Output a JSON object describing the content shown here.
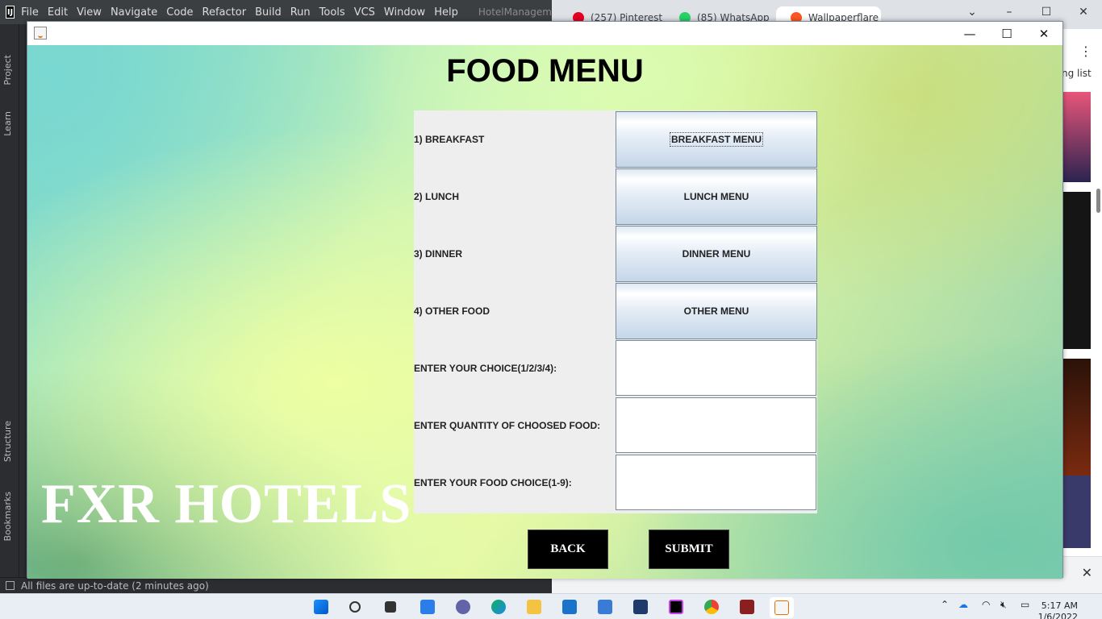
{
  "ide": {
    "menu": [
      "File",
      "Edit",
      "View",
      "Navigate",
      "Code",
      "Refactor",
      "Build",
      "Run",
      "Tools",
      "VCS",
      "Window",
      "Help"
    ],
    "project_title": "HotelManagementSystem",
    "side_tabs": {
      "project": "Project",
      "learn": "Learn",
      "structure": "Structure",
      "bookmarks": "Bookmarks"
    },
    "status": "All files are up-to-date (2 minutes ago)"
  },
  "browser": {
    "tabs": [
      {
        "label": "(257) Pinterest",
        "color": "#e60023"
      },
      {
        "label": "(85) WhatsApp",
        "color": "#25d366"
      },
      {
        "label": "Wallpaperflare",
        "color": "#ff5722"
      }
    ],
    "reading_list": "ng list"
  },
  "app": {
    "title": "FOOD MENU",
    "rows": [
      {
        "label": "1) BREAKFAST",
        "button": "BREAKFAST MENU"
      },
      {
        "label": "2) LUNCH",
        "button": "LUNCH MENU"
      },
      {
        "label": "3) DINNER",
        "button": "DINNER MENU"
      },
      {
        "label": "4) OTHER FOOD",
        "button": "OTHER MENU"
      }
    ],
    "fields": [
      {
        "label": "ENTER YOUR CHOICE(1/2/3/4):",
        "value": ""
      },
      {
        "label": "ENTER QUANTITY OF CHOOSED FOOD:",
        "value": ""
      },
      {
        "label": "ENTER YOUR FOOD CHOICE(1-9):",
        "value": ""
      }
    ],
    "hotel_name": "FXR HOTELS",
    "back_label": "BACK",
    "submit_label": "SUBMIT"
  },
  "taskbar": {
    "time": "5:17 AM",
    "date": "1/6/2022"
  }
}
